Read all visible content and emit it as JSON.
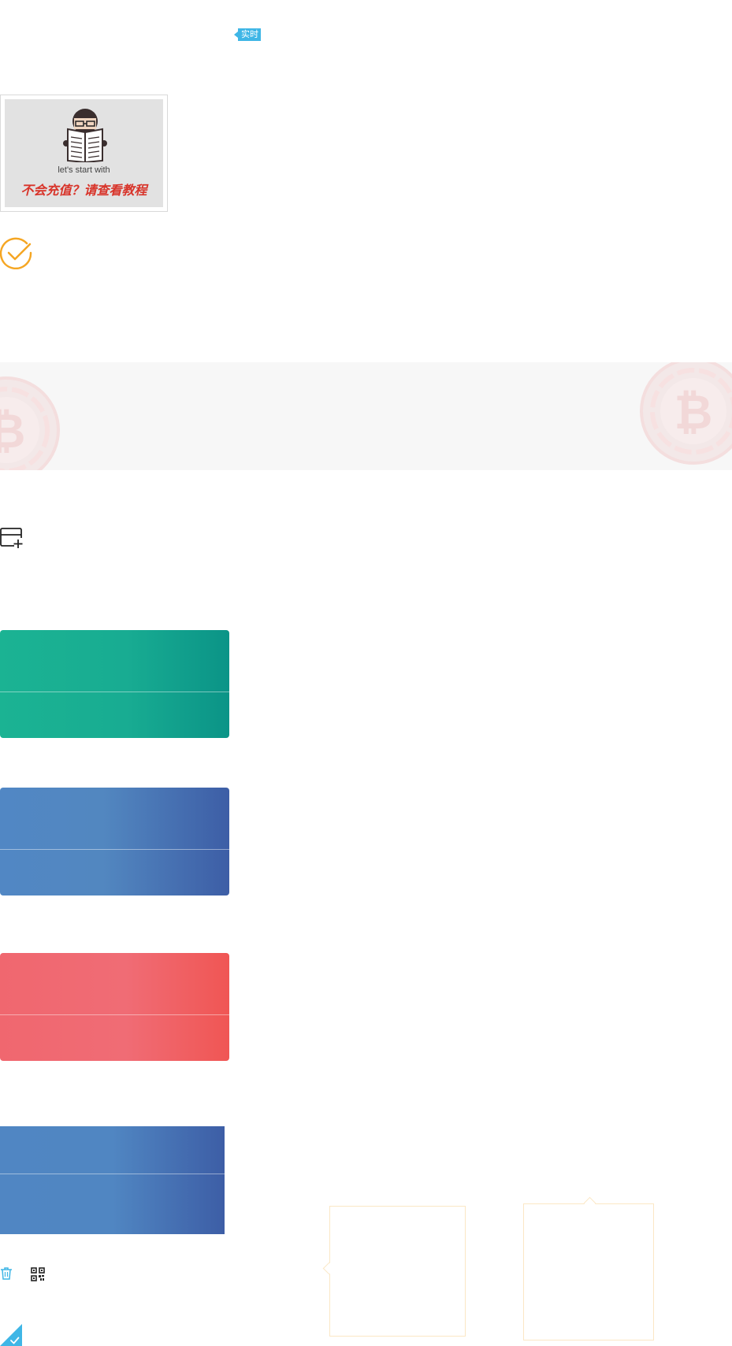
{
  "realtime_badge": {
    "label": "实时"
  },
  "tutorial": {
    "subtitle": "let's start with",
    "title": "不会充值？请查看教程"
  },
  "icons": {
    "check": "check-circle-icon",
    "add_card": "add-card-icon",
    "trash": "trash-icon",
    "qrcode": "qrcode-icon",
    "corner_check": "corner-check-icon",
    "bitcoin": "bitcoin-coin-icon",
    "reader": "newspaper-reader-icon"
  },
  "colors": {
    "accent_blue": "#3fb6e6",
    "check_orange": "#f5a623",
    "tutorial_red": "#d8342a",
    "card_green": "#1bb393",
    "card_blue": "#5187c4",
    "card_red": "#f0676f",
    "coin_pink": "#f4d4d4"
  }
}
